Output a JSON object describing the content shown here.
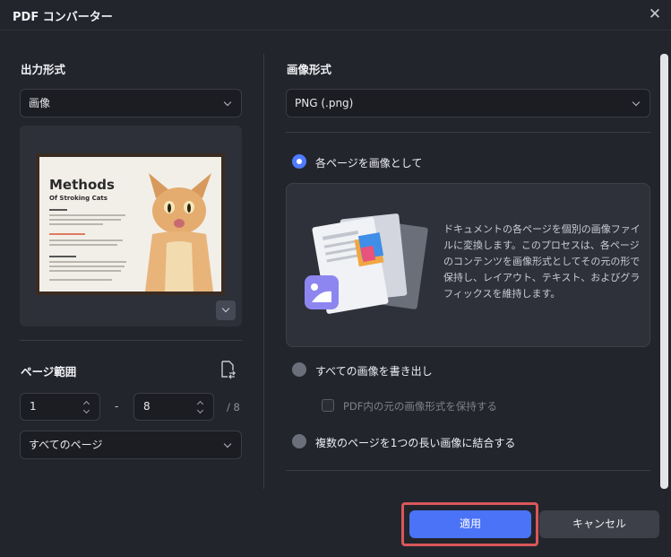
{
  "window": {
    "title": "PDF コンバーター"
  },
  "left": {
    "output_format_label": "出力形式",
    "output_format_value": "画像",
    "preview": {
      "doc_title": "Methods",
      "doc_subtitle": "Of Stroking Cats"
    },
    "page_range_label": "ページ範囲",
    "range_from": "1",
    "range_sep": "-",
    "range_to": "8",
    "range_total": "/ 8",
    "page_select_value": "すべてのページ"
  },
  "right": {
    "image_format_label": "画像形式",
    "image_format_value": "PNG (.png)",
    "options": [
      {
        "label": "各ページを画像として",
        "selected": true
      },
      {
        "label": "すべての画像を書き出し",
        "selected": false
      },
      {
        "label": "複数のページを1つの長い画像に結合する",
        "selected": false
      }
    ],
    "description": "ドキュメントの各ページを個別の画像ファイルに変換します。このプロセスは、各ページのコンテンツを画像形式としてその元の形で保持し、レイアウト、テキスト、およびグラフィックスを維持します。",
    "keep_format_checkbox": {
      "label": "PDF内の元の画像形式を保持する",
      "checked": false
    }
  },
  "footer": {
    "apply_label": "適用",
    "cancel_label": "キャンセル"
  },
  "colors": {
    "accent": "#4b73f7",
    "highlight": "#d9575a"
  },
  "icons": [
    "close-icon",
    "chevron-down-icon",
    "page-range-icon",
    "expand-preview-icon"
  ]
}
